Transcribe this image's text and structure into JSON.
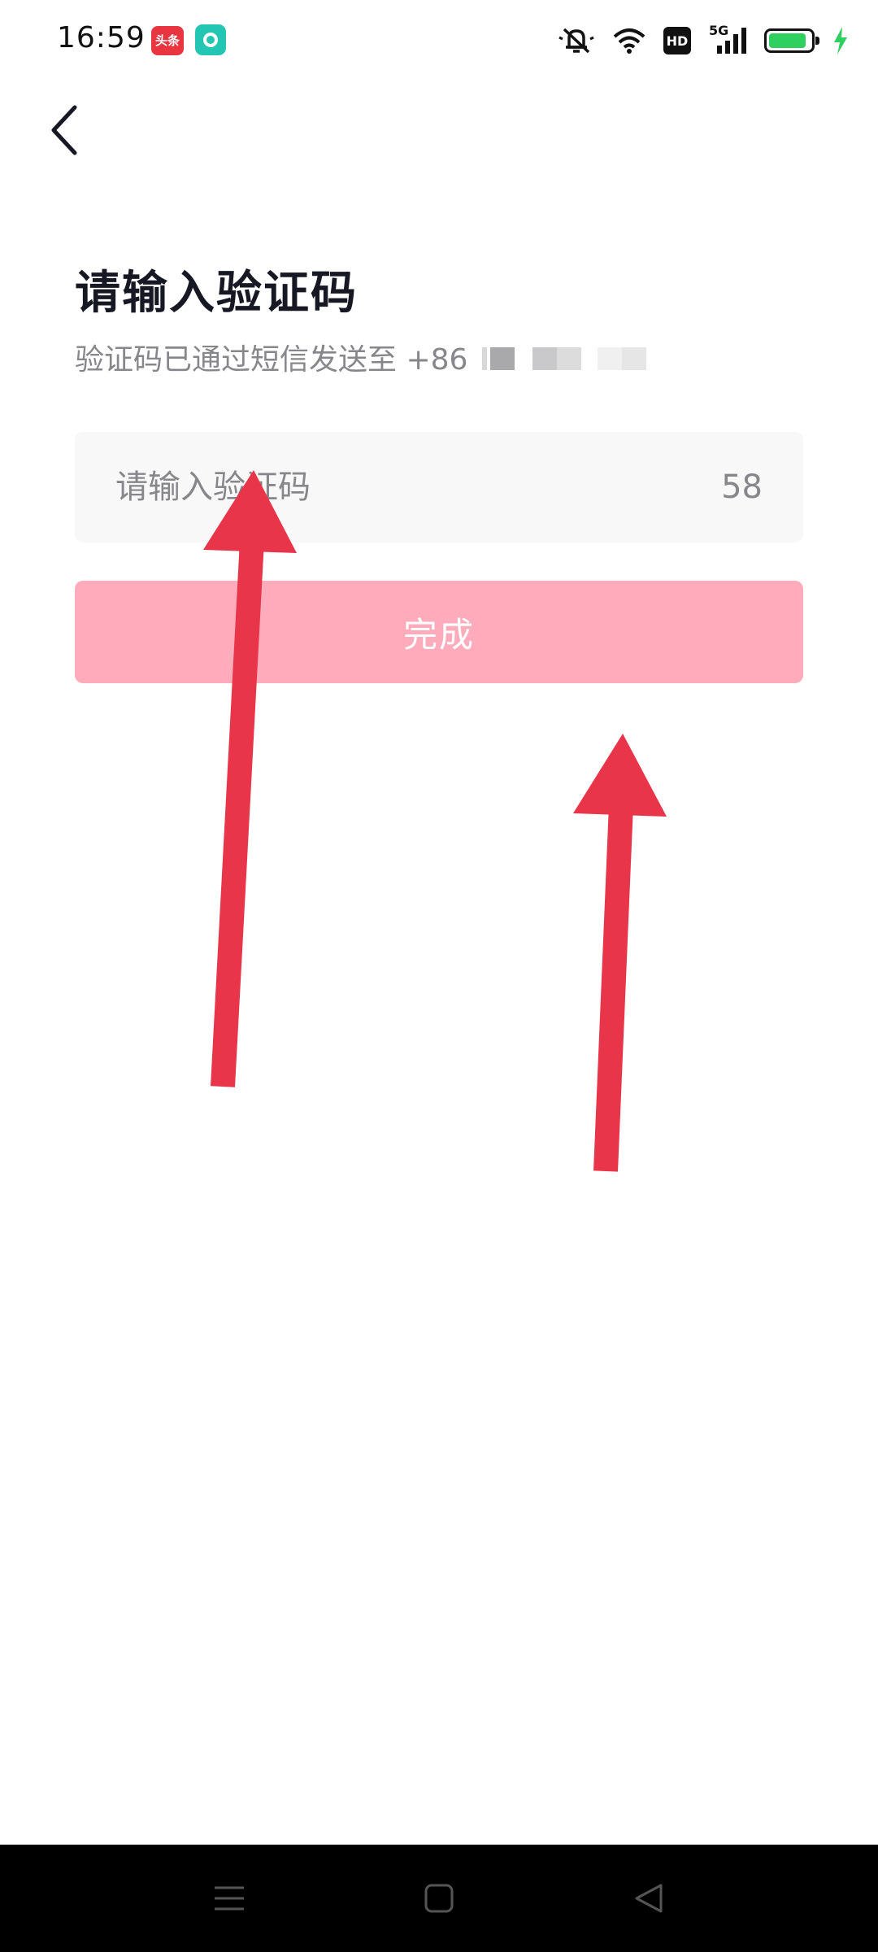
{
  "status_bar": {
    "time": "16:59",
    "app_badge_1": "头条",
    "hd_label": "HD",
    "network": "5G",
    "battery_level": 0.9,
    "colors": {
      "battery_fill": "#2fd05f",
      "charging": "#2fd05f"
    }
  },
  "header": {
    "back_icon": "chevron-left-icon"
  },
  "main": {
    "title": "请输入验证码",
    "subtitle_prefix": "验证码已通过短信发送至 +86",
    "input": {
      "placeholder": "请输入验证码",
      "value": ""
    },
    "countdown": "58",
    "done_label": "完成",
    "colors": {
      "done_button_bg": "#feacbb",
      "input_bg": "#f8f8f8",
      "arrow": "#e8354a"
    }
  },
  "nav_bar": {
    "items": [
      "menu-icon",
      "home-square-icon",
      "back-triangle-icon"
    ]
  }
}
